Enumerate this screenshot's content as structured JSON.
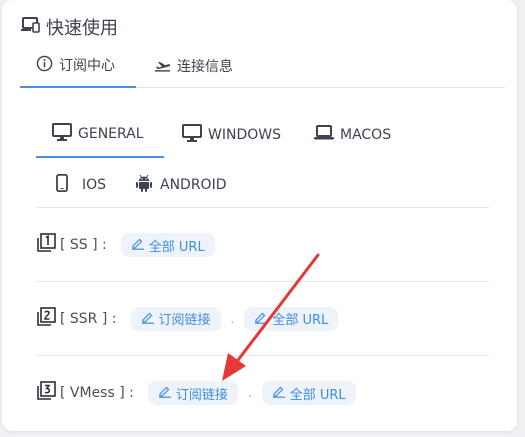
{
  "header": {
    "title": "快速使用",
    "icon": "devices-icon"
  },
  "tabs": [
    {
      "label": "订阅中心",
      "icon": "info-circle-icon",
      "active": true
    },
    {
      "label": "连接信息",
      "icon": "plane-takeoff-icon",
      "active": false
    }
  ],
  "platform_tabs": [
    {
      "label": "GENERAL",
      "icon": "monitor-icon",
      "active": true
    },
    {
      "label": "WINDOWS",
      "icon": "monitor-icon",
      "active": false
    },
    {
      "label": "MACOS",
      "icon": "laptop-icon",
      "active": false
    },
    {
      "label": "IOS",
      "icon": "phone-icon",
      "active": false
    },
    {
      "label": "ANDROID",
      "icon": "android-icon",
      "active": false
    }
  ],
  "rows": [
    {
      "label": "[ SS ] :",
      "number": "1",
      "buttons": [
        {
          "label": "全部 URL"
        }
      ]
    },
    {
      "label": "[ SSR ] :",
      "number": "2",
      "buttons": [
        {
          "label": "订阅链接"
        },
        {
          "label": "全部 URL"
        }
      ],
      "separator": "."
    },
    {
      "label": "[ VMess ] :",
      "number": "3",
      "buttons": [
        {
          "label": "订阅链接"
        },
        {
          "label": "全部 URL"
        }
      ],
      "separator": "."
    }
  ],
  "colors": {
    "accent": "#4a90e2",
    "pill_bg": "#eef3f9",
    "pill_text": "#3f8ee0",
    "arrow": "#e53935"
  }
}
